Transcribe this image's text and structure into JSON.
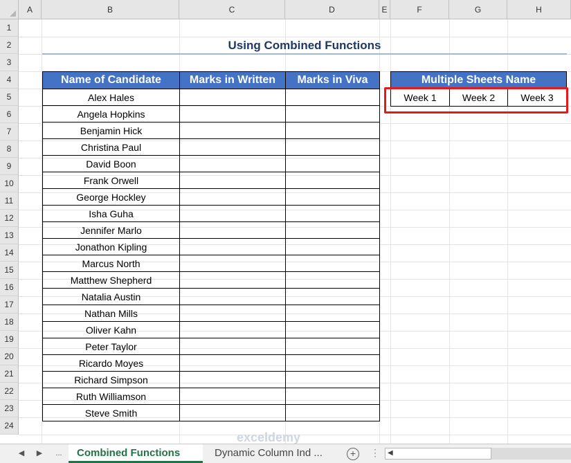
{
  "columns": [
    "A",
    "B",
    "C",
    "D",
    "E",
    "F",
    "G",
    "H"
  ],
  "rows": [
    "1",
    "2",
    "3",
    "4",
    "5",
    "6",
    "7",
    "8",
    "9",
    "10",
    "11",
    "12",
    "13",
    "14",
    "15",
    "16",
    "17",
    "18",
    "19",
    "20",
    "21",
    "22",
    "23",
    "24"
  ],
  "sheet_title": "Using Combined Functions",
  "table": {
    "headers": [
      "Name of Candidate",
      "Marks in Written",
      "Marks in Viva"
    ],
    "candidates": [
      "Alex Hales",
      "Angela Hopkins",
      "Benjamin Hick",
      "Christina Paul",
      "David Boon",
      "Frank Orwell",
      "George Hockley",
      "Isha Guha",
      "Jennifer Marlo",
      "Jonathon Kipling",
      "Marcus North",
      "Matthew Shepherd",
      "Natalia Austin",
      "Nathan Mills",
      "Oliver Kahn",
      "Peter Taylor",
      "Ricardo Moyes",
      "Richard Simpson",
      "Ruth Williamson",
      "Steve Smith"
    ]
  },
  "weeks_table": {
    "header": "Multiple Sheets Name",
    "weeks": [
      "Week 1",
      "Week 2",
      "Week 3"
    ]
  },
  "tabs": {
    "ellipsis": "...",
    "active": "Combined Functions",
    "inactive": "Dynamic Column Ind ...",
    "add_icon": "+",
    "more_icon": "⋮"
  },
  "watermark": "exceldemy",
  "colors": {
    "header_fill": "#4472c4",
    "title_color": "#203864",
    "highlight": "#e3191c",
    "active_tab": "#217346"
  }
}
